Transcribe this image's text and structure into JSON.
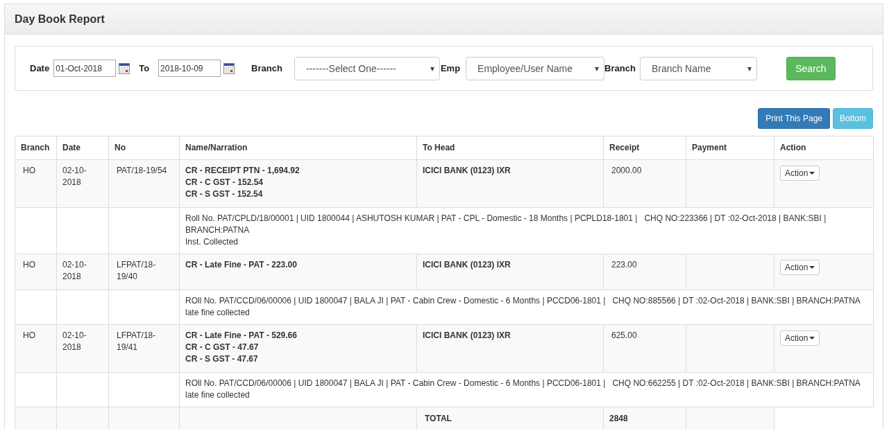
{
  "title": "Day Book Report",
  "filters": {
    "date_label": "Date",
    "date_from": "01-Oct-2018",
    "to_label": "To",
    "date_to": "2018-10-09",
    "branch_label": "Branch",
    "branch_select": "-------Select One------",
    "emp_label": "Emp",
    "emp_select": "Employee/User Name",
    "branch2_label": "Branch",
    "branch2_select": "Branch Name",
    "search_button": "Search"
  },
  "buttons": {
    "print": "Print This Page",
    "bottom": "Bottom"
  },
  "table": {
    "columns": [
      "Branch",
      "Date",
      "No",
      "Name/Narration",
      "To Head",
      "Receipt",
      "Payment",
      "Action"
    ],
    "rows": [
      {
        "branch": "HO",
        "date": "02-10-2018",
        "no": "PAT/18-19/54",
        "names": [
          "CR - RECEIPT PTN - 1,694.92",
          "CR - C GST - 152.54",
          "CR - S GST - 152.54"
        ],
        "to_head": "ICICI BANK (0123) IXR",
        "receipt": "2000.00",
        "action": "Action",
        "narration": [
          "Roll No. PAT/CPLD/18/00001 | UID 1800044 | ASHUTOSH KUMAR | PAT - CPL - Domestic - 18 Months | PCPLD18-1801 |   CHQ NO:223366 | DT :02-Oct-2018 | BANK:SBI | BRANCH:PATNA",
          "Inst. Collected"
        ]
      },
      {
        "branch": "HO",
        "date": "02-10-2018",
        "no": "LFPAT/18-19/40",
        "names": [
          "CR - Late Fine - PAT - 223.00"
        ],
        "to_head": "ICICI BANK (0123) IXR",
        "receipt": "223.00",
        "action": "Action",
        "narration": [
          "ROll No. PAT/CCD/06/00006 | UID 1800047 | BALA JI | PAT - Cabin Crew - Domestic - 6 Months | PCCD06-1801 |   CHQ NO:885566 | DT :02-Oct-2018 | BANK:SBI | BRANCH:PATNA",
          "late fine collected"
        ]
      },
      {
        "branch": "HO",
        "date": "02-10-2018",
        "no": "LFPAT/18-19/41",
        "names": [
          "CR - Late Fine - PAT - 529.66",
          "CR - C GST - 47.67",
          "CR - S GST - 47.67"
        ],
        "to_head": "ICICI BANK (0123) IXR",
        "receipt": "625.00",
        "action": "Action",
        "narration": [
          "ROll No. PAT/CCD/06/00006 | UID 1800047 | BALA JI | PAT - Cabin Crew - Domestic - 6 Months | PCCD06-1801 |   CHQ NO:662255 | DT :02-Oct-2018 | BANK:SBI | BRANCH:PATNA",
          "late fine collected"
        ]
      }
    ],
    "total_label": "TOTAL",
    "total_receipt": "2848"
  }
}
